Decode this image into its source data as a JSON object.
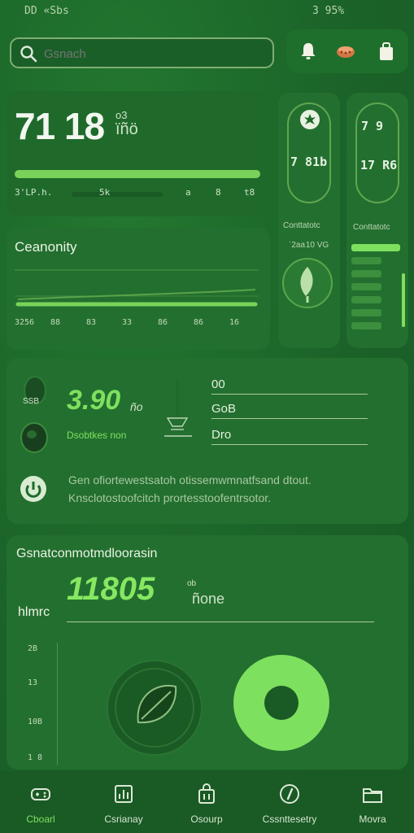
{
  "status_bar": {
    "left": "DD «Sbs",
    "right": "3 95%"
  },
  "search": {
    "placeholder": "Gsnach",
    "value": ""
  },
  "header_icons": [
    {
      "name": "bell-icon",
      "color": "#f2f2e6"
    },
    {
      "name": "basket-icon",
      "color": "#e08850"
    },
    {
      "name": "bag-icon",
      "color": "#f2f2e6"
    }
  ],
  "metric_card": {
    "value": "71 18",
    "unit_small": "o3",
    "unit": "ïñö",
    "progress": 1.0,
    "footer": [
      "3'LP.h.",
      "5k",
      "a",
      "8",
      "t8"
    ]
  },
  "chart_card": {
    "title": "Ceanonity",
    "ticks": [
      "3256",
      "88",
      "83",
      "33",
      "86",
      "86",
      "16"
    ]
  },
  "chart_data": {
    "type": "line",
    "title": "Ceanonity",
    "x": [
      "3256",
      "88",
      "83",
      "33",
      "86",
      "86",
      "16"
    ],
    "series": [
      {
        "values": [
          1,
          1,
          1,
          1,
          1,
          1,
          1
        ]
      }
    ],
    "grid": true
  },
  "side_card_left": {
    "pill_value": "7 81b",
    "label": "Conttatotc",
    "sub_label": "ʿ2aa 10 ​VG",
    "icon": "leaf-icon"
  },
  "side_card_right": {
    "pill_top": "7 9",
    "pill_value": "17 R6",
    "label": "Conttatotc",
    "levels": [
      1.0,
      0.62,
      0.62,
      0.62,
      0.62,
      0.62,
      0.62
    ]
  },
  "detail_card": {
    "value": "3.90",
    "unit": "ño",
    "label": "Dsobtkes non",
    "side_label": "SSB",
    "fields": [
      "00",
      "GoB",
      "Dro"
    ],
    "description_lines": [
      "Gen ofiortewestsatoh otissemwmnatfsand dtout.",
      "Knsclotostoofcitch prortesstoofentrsotor."
    ]
  },
  "bottom_card": {
    "title": "Gsnatconmotmdloorasin",
    "value": "11805",
    "unit_small": "ob",
    "unit": "ñone",
    "side_label": "hlmrc",
    "yticks": [
      "2B",
      "13",
      "10B",
      "1 8"
    ]
  },
  "nav": {
    "items": [
      {
        "label": "Cboarl",
        "icon": "gamepad-icon",
        "active": true
      },
      {
        "label": "Csrianay",
        "icon": "stats-icon",
        "active": false
      },
      {
        "label": "Osourp",
        "icon": "bag-icon",
        "active": false
      },
      {
        "label": "Cssnttesetry",
        "icon": "compass-icon",
        "active": false
      },
      {
        "label": "Movra",
        "icon": "folder-icon",
        "active": false
      }
    ]
  },
  "colors": {
    "background": "#1d6b2c",
    "card": "#236f2f",
    "accent": "#7ee05f",
    "text": "#e8f3e4"
  }
}
